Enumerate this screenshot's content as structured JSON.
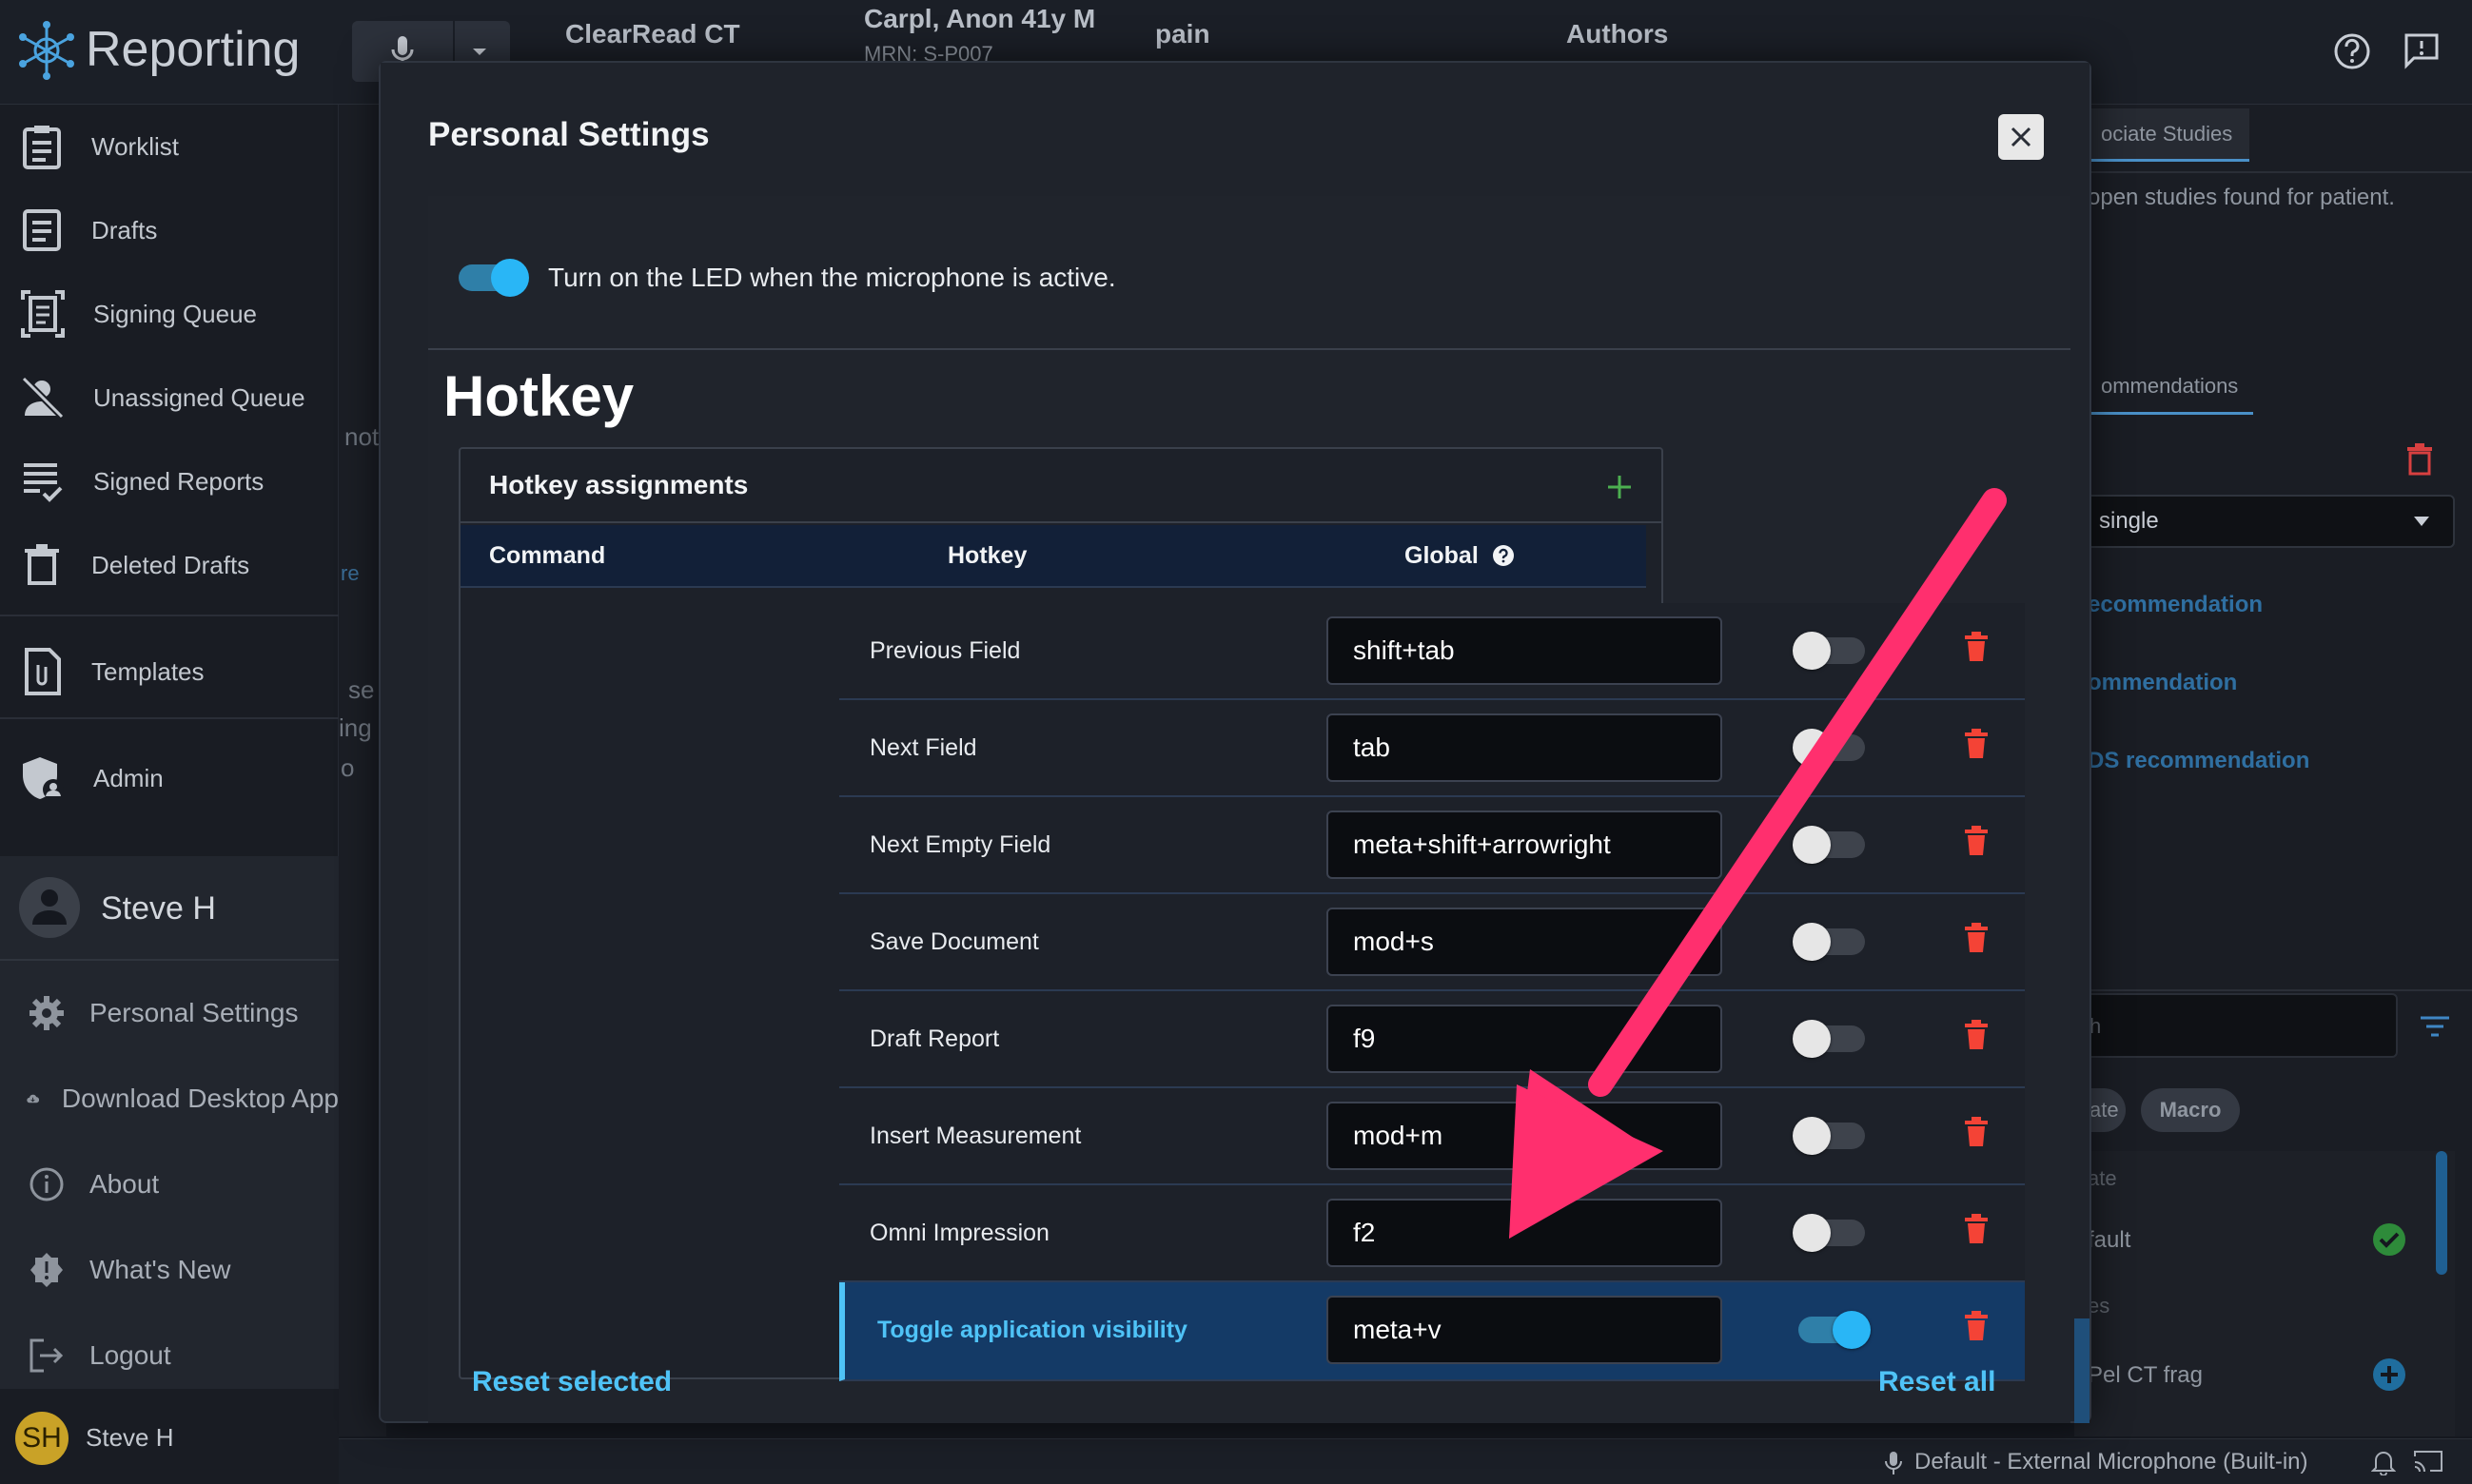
{
  "app": {
    "name": "Reporting"
  },
  "topbar": {
    "study": "ClearRead CT",
    "patient": "Carpl, Anon 41y M",
    "mrn": "MRN: S-P007",
    "indication": "pain",
    "authors": "Authors"
  },
  "sidebar": {
    "items": [
      {
        "label": "Worklist",
        "icon": "worklist-icon"
      },
      {
        "label": "Drafts",
        "icon": "drafts-icon"
      },
      {
        "label": "Signing Queue",
        "icon": "signing-queue-icon"
      },
      {
        "label": "Unassigned Queue",
        "icon": "unassigned-icon"
      },
      {
        "label": "Signed Reports",
        "icon": "signed-reports-icon"
      },
      {
        "label": "Deleted Drafts",
        "icon": "trash-icon"
      },
      {
        "label": "Templates",
        "icon": "templates-icon"
      },
      {
        "label": "Admin",
        "icon": "admin-icon"
      }
    ],
    "user_name": "Steve H",
    "user_menu": [
      {
        "label": "Personal Settings",
        "icon": "gear-icon"
      },
      {
        "label": "Download Desktop App",
        "icon": "cloud-download-icon"
      },
      {
        "label": "About",
        "icon": "info-icon"
      },
      {
        "label": "What's New",
        "icon": "badge-icon"
      },
      {
        "label": "Logout",
        "icon": "logout-icon"
      }
    ],
    "footer_initials": "SH",
    "footer_name": "Steve H",
    "peek": {
      "not": "not",
      "re": "re",
      "se": "se",
      "ing": "ing",
      "o": "o"
    }
  },
  "right_panel": {
    "tab_associate": "ociate Studies",
    "no_studies": "open studies found for patient.",
    "tab_recommendations": "ommendations",
    "select_value": "single",
    "links": [
      "ecommendation",
      "ommendation",
      "DS recommendation"
    ],
    "search_placeholder": "h",
    "chip_1": "ate",
    "chip_2": "Macro",
    "list": [
      "ate",
      "fault",
      "es",
      "Pel CT frag"
    ]
  },
  "statusbar": {
    "mic": "Default - External Microphone (Built-in)"
  },
  "modal": {
    "title": "Personal Settings",
    "led_label": "Turn on the LED when the microphone is active.",
    "led_on": true,
    "section_title": "Hotkey",
    "card_title": "Hotkey assignments",
    "columns": {
      "command": "Command",
      "hotkey": "Hotkey",
      "global": "Global"
    },
    "rows": [
      {
        "command": "Previous Field",
        "hotkey": "shift+tab",
        "global": false
      },
      {
        "command": "Next Field",
        "hotkey": "tab",
        "global": false
      },
      {
        "command": "Next Empty Field",
        "hotkey": "meta+shift+arrowright",
        "global": false
      },
      {
        "command": "Save Document",
        "hotkey": "mod+s",
        "global": false
      },
      {
        "command": "Draft Report",
        "hotkey": "f9",
        "global": false
      },
      {
        "command": "Insert Measurement",
        "hotkey": "mod+m",
        "global": false
      },
      {
        "command": "Omni Impression",
        "hotkey": "f2",
        "global": false
      },
      {
        "command": "Toggle application visibility",
        "hotkey": "meta+v",
        "global": true,
        "selected": true
      }
    ],
    "reset_selected": "Reset selected",
    "reset_all": "Reset all"
  },
  "colors": {
    "accent": "#29b6f6",
    "link": "#4fc3f7",
    "danger": "#f44336",
    "arrow": "#ff2f6e",
    "add": "#4caf50"
  }
}
